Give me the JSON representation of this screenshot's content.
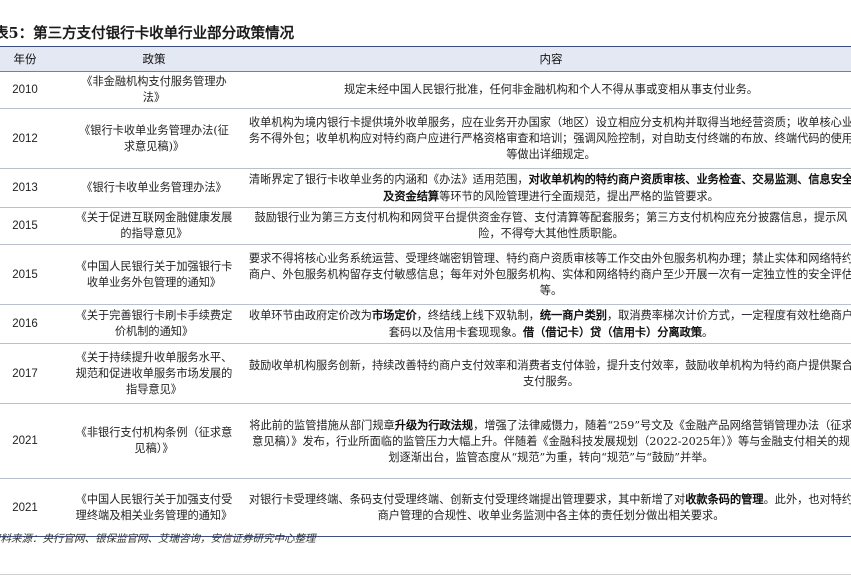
{
  "title": "表5：第三方支付银行卡收单行业部分政策情况",
  "table": {
    "headers": [
      "年份",
      "政策",
      "内容"
    ],
    "rows": [
      {
        "year": "2010",
        "policy": "《非金融机构支付服务管理办法》",
        "content": [
          {
            "t": "规定未经中国人民银行批准，任何非金融机构和个人不得从事或变相从事支付业务。",
            "b": false
          }
        ]
      },
      {
        "year": "2012",
        "policy": "《银行卡收单业务管理办法(征求意见稿)》",
        "content": [
          {
            "t": "收单机构为境内银行卡提供境外收单服务，应在业务开办国家（地区）设立相应分支机构并取得当地经营资质；收单核心业务不得外包；收单机构应对特约商户应进行严格资格审查和培训；强调风险控制，对自助支付终端的布放、终端代码的使用等做出详细规定。",
            "b": false
          }
        ]
      },
      {
        "year": "2013",
        "policy": "《银行卡收单业务管理办法》",
        "content": [
          {
            "t": "清晰界定了银行卡收单业务的内涵和《办法》适用范围，",
            "b": false
          },
          {
            "t": "对收单机构的特约商户资质审核、业务检查、交易监测、信息安全及资金结算",
            "b": true
          },
          {
            "t": "等环节的风险管理进行全面规范，提出严格的监管要求。",
            "b": false
          }
        ]
      },
      {
        "year": "2015",
        "policy": "《关于促进互联网金融健康发展的指导意见》",
        "content": [
          {
            "t": "鼓励银行业为第三方支付机构和网贷平台提供资金存管、支付清算等配套服务；第三方支付机构应充分披露信息，提示风险，不得夸大其他性质职能。",
            "b": false
          }
        ]
      },
      {
        "year": "2015",
        "policy": "《中国人民银行关于加强银行卡收单业务外包管理的通知》",
        "content": [
          {
            "t": "要求不得将核心业务系统运营、受理终端密钥管理、特约商户资质审核等工作交由外包服务机构办理；禁止实体和网络特约商户、外包服务机构留存支付敏感信息；每年对外包服务机构、实体和网络特约商户至少开展一次有一定独立性的安全评估等。",
            "b": false
          }
        ]
      },
      {
        "year": "2016",
        "policy": "《关于完善银行卡刷卡手续费定价机制的通知》",
        "content": [
          {
            "t": "收单环节由政府定价改为",
            "b": false
          },
          {
            "t": "市场定价",
            "b": true
          },
          {
            "t": "，终结线上线下双轨制，",
            "b": false
          },
          {
            "t": "统一商户类别",
            "b": true
          },
          {
            "t": "，取消费率梯次计价方式，一定程度有效杜绝商户套码以及信用卡套现现象。",
            "b": false
          },
          {
            "t": "借（借记卡）贷（信用卡）分离政策",
            "b": true
          },
          {
            "t": "。",
            "b": false
          }
        ]
      },
      {
        "year": "2017",
        "policy": "《关于持续提升收单服务水平、规范和促进收单服务市场发展的指导意见》",
        "content": [
          {
            "t": "鼓励收单机构服务创新，持续改善特约商户支付效率和消费者支付体验，提升支付效率，鼓励收单机构为特约商户提供聚合支付服务。",
            "b": false
          }
        ]
      },
      {
        "year": "2021",
        "policy": "《非银行支付机构条例（征求意见稿）》",
        "content": [
          {
            "t": "将此前的监管措施从部门规章",
            "b": false
          },
          {
            "t": "升级为行政法规",
            "b": true
          },
          {
            "t": "，增强了法律威慑力，随着“259”号文及《金融产品网络营销管理办法（征求意见稿）》发布，行业所面临的监管压力大幅上升。伴随着《金融科技发展规划（2022-2025年）》等与金融支付相关的规划逐渐出台，监管态度从“规范”为重，转向“规范”与“鼓励”并举。",
            "b": false
          }
        ]
      },
      {
        "year": "2021",
        "policy": "《中国人民银行关于加强支付受理终端及相关业务管理的通知》",
        "content": [
          {
            "t": "对银行卡受理终端、条码支付受理终端、创新支付受理终端提出管理要求，其中新增了对",
            "b": false
          },
          {
            "t": "收款条码的管理",
            "b": true
          },
          {
            "t": "。此外，也对特约商户管理的合规性、收单业务监测中各主体的责任划分做出相关要求。",
            "b": false
          }
        ]
      }
    ]
  },
  "source": "资料来源：央行官网、银保监官网、艾瑞咨询，安信证券研究中心整理"
}
